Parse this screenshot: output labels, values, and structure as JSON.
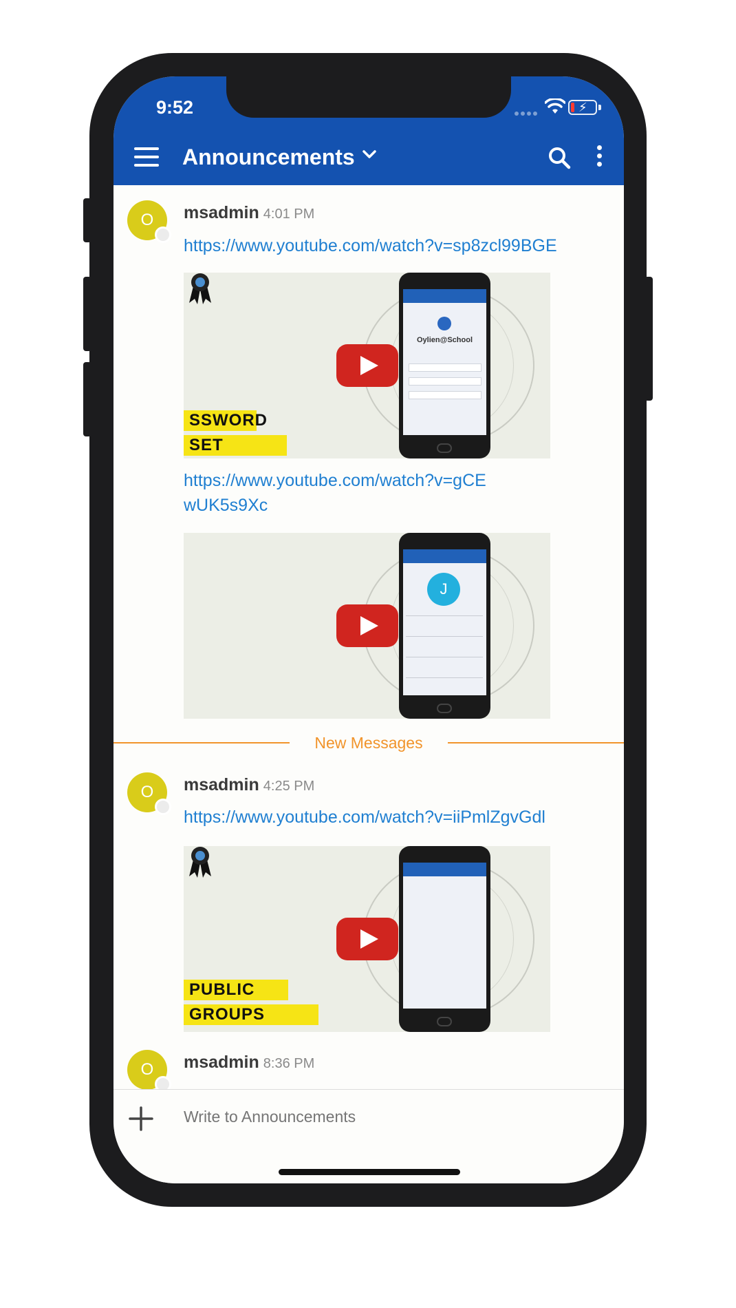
{
  "status_bar": {
    "time": "9:52"
  },
  "header": {
    "title": "Announcements"
  },
  "messages": [
    {
      "avatar": "O",
      "user": "msadmin",
      "time": "4:01 PM",
      "link": "https://www.youtube.com/watch?v=sp8zcl99BGE",
      "banner_lines": [
        "SSWORD",
        "SET"
      ],
      "phone_label": "Oylien@School"
    },
    {
      "link": "https://www.youtube.com/watch?v=gCEwUK5s9Xc",
      "phone_avatar": "J"
    },
    {
      "avatar": "O",
      "user": "msadmin",
      "time": "4:25 PM",
      "link": "https://www.youtube.com/watch?v=iiPmlZgvGdl",
      "banner_lines": [
        "PUBLIC",
        "GROUPS"
      ]
    },
    {
      "avatar": "O",
      "user": "msadmin",
      "time": "8:36 PM"
    }
  ],
  "divider": {
    "label": "New Messages"
  },
  "composer": {
    "placeholder": "Write to Announcements"
  },
  "colors": {
    "header": "#1452b0",
    "link": "#1f7fd1",
    "divider": "#f1942b",
    "avatar": "#d9cc1a",
    "play": "#d0251f",
    "banner": "#f6e415"
  }
}
